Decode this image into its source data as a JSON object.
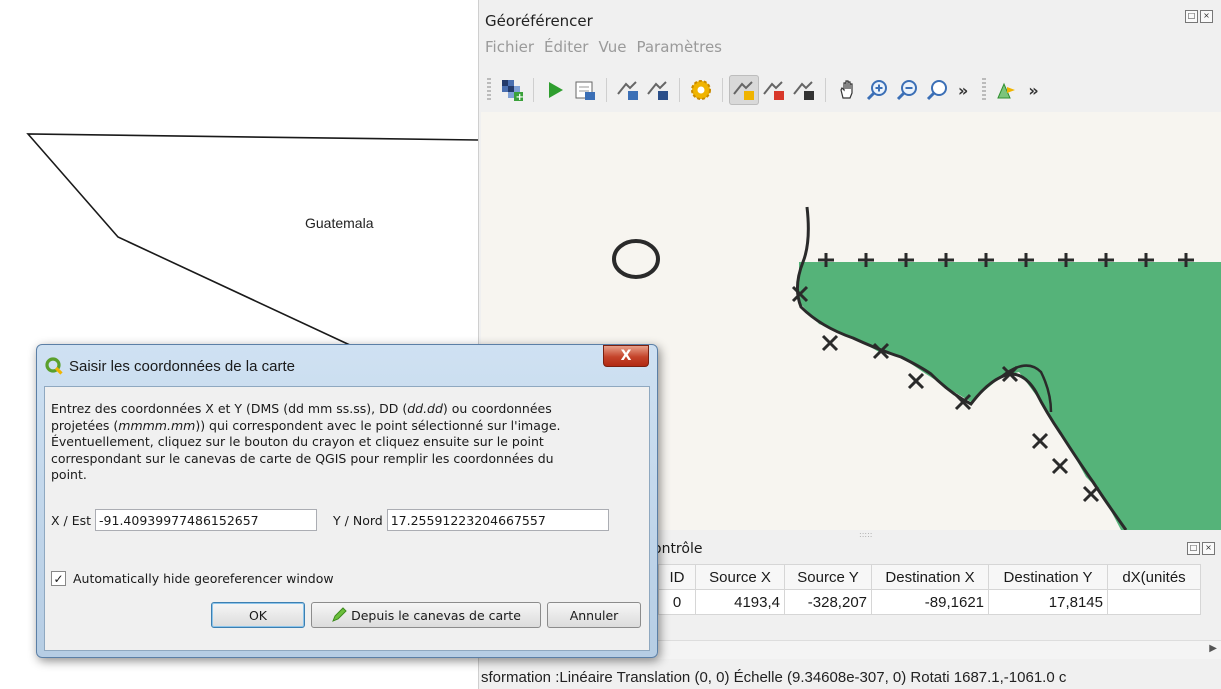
{
  "map": {
    "country_label": "Guatemala"
  },
  "georef": {
    "title": "Géoréférencer",
    "menu": [
      "Fichier",
      "Éditer",
      "Vue",
      "Paramètres"
    ],
    "toolbar_more": "»",
    "gcp_panel_title": "ontrôle",
    "table": {
      "columns": [
        "ID",
        "Source X",
        "Source Y",
        "Destination X",
        "Destination Y",
        "dX(unités"
      ],
      "rows": [
        [
          "0",
          "4193,4",
          "-328,207",
          "-89,1621",
          "17,8145",
          ""
        ]
      ]
    },
    "status": "sformation :Linéaire Translation (0, 0) Échelle (9.34608e-307, 0) Rotati  1687.1,-1061.0  c"
  },
  "dialog": {
    "title": "Saisir les coordonnées de la carte",
    "close_label": "X",
    "description_lines": [
      "Entrez des coordonnées X et Y (DMS (dd mm ss.ss), DD (dd.dd) ou coordonnées",
      "projetées (mmmm.mm)) qui correspondent avec le point sélectionné sur l'image.",
      "Éventuellement, cliquez sur le bouton du crayon et cliquez ensuite sur le point",
      "correspondant sur le canevas de carte de QGIS pour remplir les coordonnées du",
      "point."
    ],
    "x_label": "X / Est",
    "x_value": "-91.40939977486152657",
    "y_label": "Y / Nord",
    "y_value": "17.25591223204667557",
    "checkbox_label": "Automatically hide georeferencer window",
    "checkbox_checked": true,
    "ok_label": "OK",
    "from_canvas_label": "Depuis le canevas de carte",
    "cancel_label": "Annuler"
  },
  "colors": {
    "land_green": "#4caf72",
    "accent_blue": "#3c7fb1",
    "close_red": "#c4432a"
  },
  "icons": [
    "open-raster-icon",
    "start-georef-icon",
    "generate-script-icon",
    "load-gcp-icon",
    "save-gcp-icon",
    "settings-icon",
    "add-point-icon",
    "delete-point-icon",
    "move-point-icon",
    "pan-icon",
    "zoom-in-icon",
    "zoom-out-icon",
    "zoom-layer-icon",
    "link-icon"
  ]
}
